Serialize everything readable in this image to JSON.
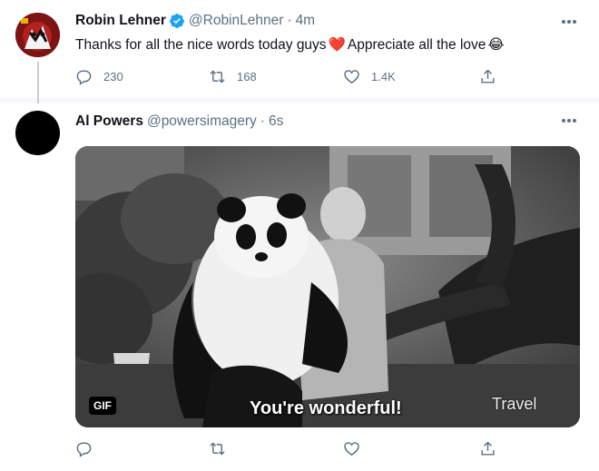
{
  "tweet1": {
    "display_name": "Robin Lehner",
    "handle": "@RobinLehner",
    "sep": "·",
    "time": "4m",
    "text_before": "Thanks for all the nice words today guys",
    "heart_emoji": "❤️",
    "text_after": "Appreciate all the love",
    "laugh_emoji": "😂",
    "replies": "230",
    "retweets": "168",
    "likes": "1.4K"
  },
  "tweet2": {
    "display_name": "Al Powers",
    "handle": "@powersimagery",
    "sep": "·",
    "time": "6s",
    "gif_badge": "GIF",
    "gif_caption": "You're wonderful!",
    "gif_brand": "Travel"
  },
  "colors": {
    "verified": "#1da1f2",
    "meta_gray": "#5b7083",
    "heart_red": "#e0245e"
  }
}
